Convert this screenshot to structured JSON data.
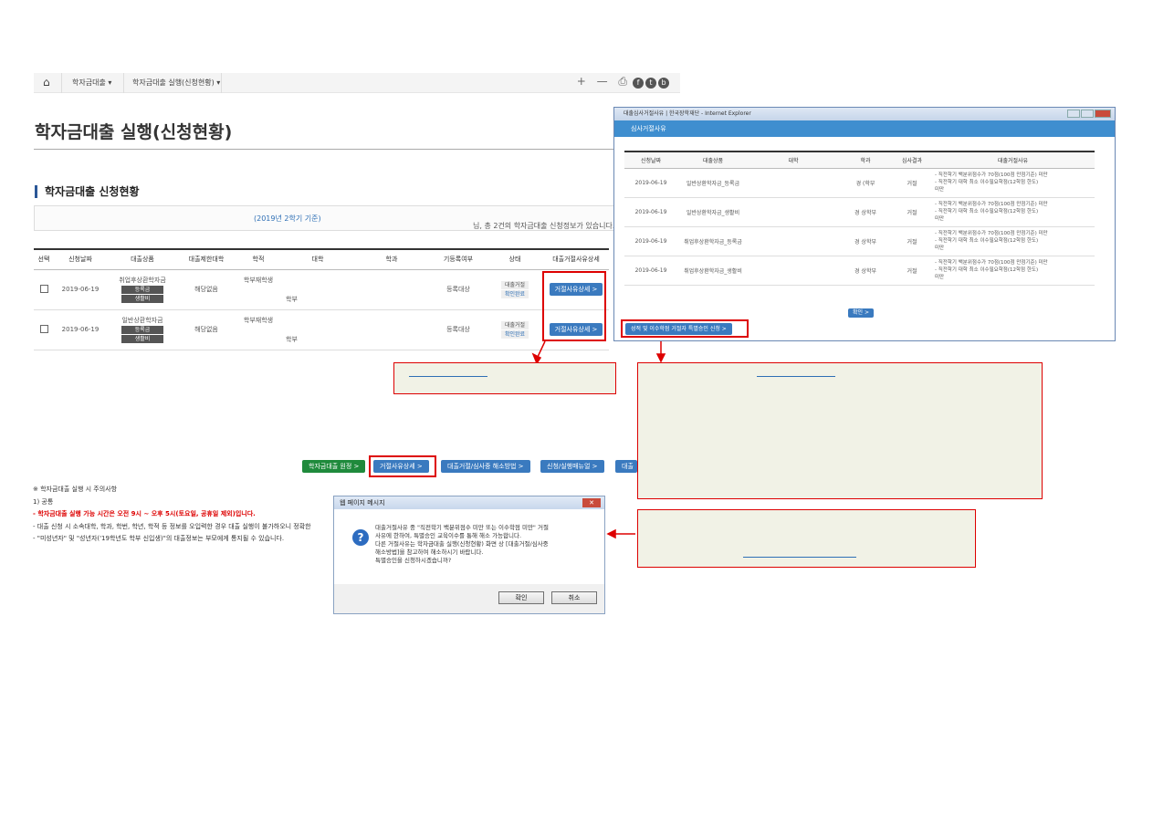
{
  "breadcrumb": {
    "home_icon": "home-icon",
    "item1": "학자금대출",
    "item2": "학자금대출 실행(신청현황)",
    "tools": "+ — ⎙",
    "icon_fb": "f",
    "icon_tw": "t",
    "icon_blog": "b"
  },
  "page_title": "학자금대출 실행(신청현황)",
  "section_title": "학자금대출 신청현황",
  "info": {
    "text_prefix": "님, 총 2건의 학자금대출 신청정보가 있습니다.",
    "text_highlight": "(2019년 2학기 기준)"
  },
  "main_table": {
    "headers": [
      "선택",
      "신청날짜",
      "대출상품",
      "대출제한대학",
      "학적",
      "대학",
      "학과",
      "기등록여부",
      "상태",
      "대출거절사유상세"
    ],
    "rows": [
      {
        "date": "2019-06-19",
        "product": "취업후상환학자금",
        "badge1": "등록금",
        "badge2": "생활비",
        "restrict": "해당없음",
        "status_academic": "학부재학생",
        "college": "학부",
        "registered": "등록대상",
        "state1": "대출거절",
        "state2": "확인완료",
        "action": "거절사유상세 >"
      },
      {
        "date": "2019-06-19",
        "product": "일반상환학자금",
        "badge1": "등록금",
        "badge2": "생활비",
        "restrict": "해당없음",
        "status_academic": "학부재학생",
        "college": "학부",
        "registered": "등록대상",
        "state1": "대출거절",
        "state2": "확인완료",
        "action": "거절사유상세 >"
      }
    ]
  },
  "bottom_buttons": {
    "b1": "학자금대출 원정 >",
    "b2": "거절사유상세 >",
    "b3": "대출거절/심사중 해소방법 >",
    "b4": "신청/실행매뉴얼 >",
    "b5": "대출"
  },
  "notes": {
    "title": "※ 학자금대출 실행 시 주의사항",
    "sub": "1) 공통",
    "line1": "- 학자금대출 실행 가능 시간은 오전 9시 ~ 오후 5시(토요일, 공휴일 제외)입니다.",
    "line2": "- 대출 신청 시 소속대학, 학과, 학번, 학년, 학적 등 정보를 오입력한 경우 대출 실행이 불가하오니 정확한",
    "line3": "- \"미성년자\" 및 \"성년자('19학년도 학부 신입생)\"의 대출정보는 부모에게 통지될 수 있습니다."
  },
  "popup": {
    "window_title": "대출심사거절사유 | 한국장학재단 - Internet Explorer",
    "header": "심사거절사유",
    "headers": [
      "신청날짜",
      "대출상품",
      "대학",
      "학과",
      "심사결과",
      "대출거절사유"
    ],
    "rows": [
      {
        "date": "2019-06-19",
        "product": "일반상환학자금_등록금",
        "dept": "경    (학부",
        "result": "거절",
        "reason1": "- 직전학기 백분위점수가 70점(100점 만점기준) 미만",
        "reason2": "- 직전학기 대학 최소 이수필요학점(12학점 한도)",
        "reason3": "미만"
      },
      {
        "date": "2019-06-19",
        "product": "일반상환학자금_생활비",
        "dept": "경    상학부",
        "result": "거절",
        "reason1": "- 직전학기 백분위점수가 70점(100점 만점기준) 미만",
        "reason2": "- 직전학기 대학 최소 이수필요학점(12학점 한도)",
        "reason3": "미만"
      },
      {
        "date": "2019-06-19",
        "product": "취업후상환학자금_등록금",
        "dept": "경    상학부",
        "result": "거절",
        "reason1": "- 직전학기 백분위점수가 70점(100점 만점기준) 미만",
        "reason2": "- 직전학기 대학 최소 이수필요학점(12학점 한도)",
        "reason3": "미만"
      },
      {
        "date": "2019-06-19",
        "product": "취업후상환학자금_생활비",
        "dept": "경    상학부",
        "result": "거절",
        "reason1": "- 직전학기 백분위점수가 70점(100점 만점기준) 미만",
        "reason2": "- 직전학기 대학 최소 이수필요학점(12학점 한도)",
        "reason3": "미만"
      }
    ],
    "ok_button": "확인 >",
    "special_button": "성적 및 이수학점 거절자 특별승인 신청 >"
  },
  "dialog": {
    "title": "웹 페이지 메시지",
    "close": "✕",
    "line1": "대출거절사유 중 \"직전학기 백분위점수 미만 또는 이수학점 미만\" 거절",
    "line2": "사유에 한하여, 특별승인 교육이수를 통해 해소 가능합니다.",
    "line3": "다른 거절사유는 학자금대출 실행(신청현황) 화면 상 [대출거절/심사중",
    "line4": "해소방법]을 참고하여 해소하시기 바랍니다.",
    "line5": "특별승인을 신청하시겠습니까?",
    "ok": "확인",
    "cancel": "취소"
  },
  "colors": {
    "accent_blue": "#3a7abf",
    "annotation_red": "#d00000",
    "note_bg": "#f1f2e6",
    "green_button": "#1f8a3c"
  }
}
